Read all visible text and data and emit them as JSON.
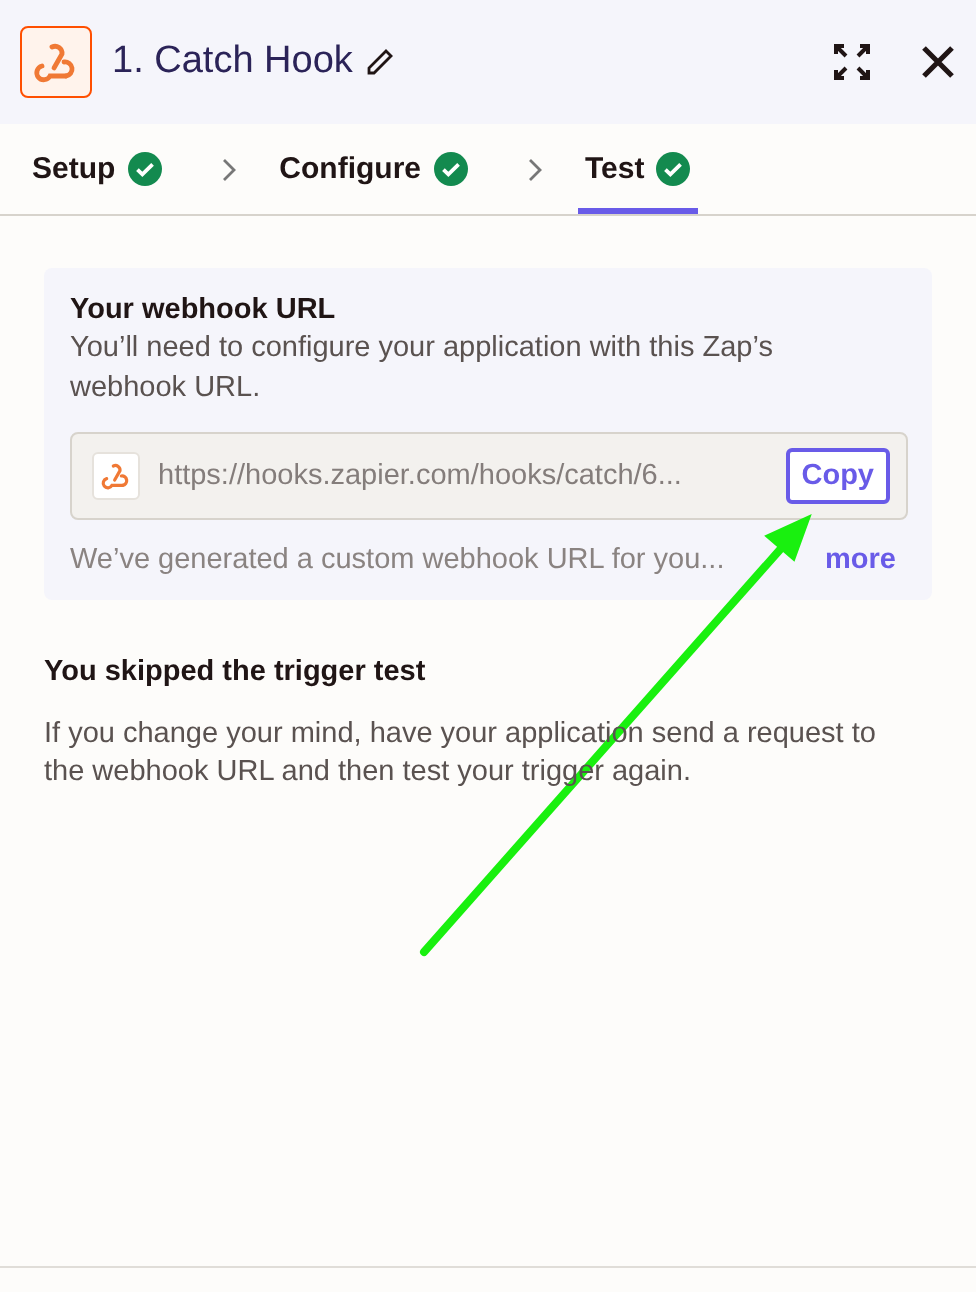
{
  "header": {
    "title": "1. Catch Hook"
  },
  "tabs": [
    {
      "label": "Setup",
      "completed": true,
      "selected": false
    },
    {
      "label": "Configure",
      "completed": true,
      "selected": false
    },
    {
      "label": "Test",
      "completed": true,
      "selected": true
    }
  ],
  "webhook": {
    "title": "Your webhook URL",
    "description": "You’ll need to configure your application with this Zap’s webhook URL.",
    "url": "https://hooks.zapier.com/hooks/catch/6...",
    "copy_button": "Copy",
    "note": "We’ve generated a custom webhook URL for you...",
    "more_link": "more"
  },
  "skipped": {
    "title": "You skipped the trigger test",
    "body": "If you change your mind, have your application send a request to the webhook URL and then test your trigger again."
  }
}
